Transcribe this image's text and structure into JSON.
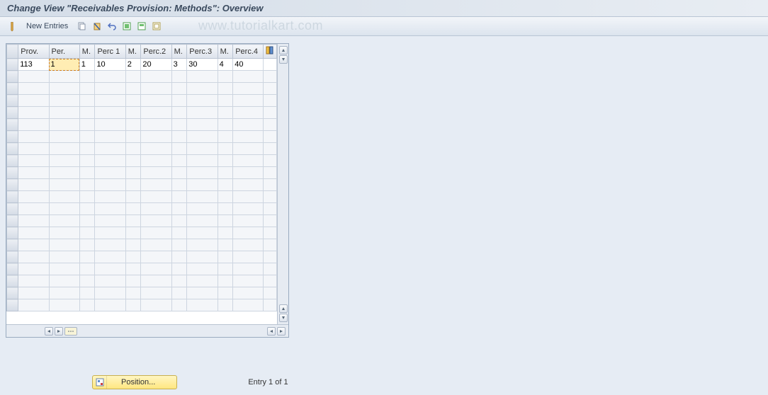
{
  "title": "Change View \"Receivables Provision: Methods\": Overview",
  "toolbar": {
    "new_entries": "New Entries"
  },
  "watermark": "www.tutorialkart.com",
  "columns": {
    "prov": "Prov.",
    "per": "Per.",
    "m1": "M.",
    "perc1": "Perc 1",
    "m2": "M.",
    "perc2": "Perc.2",
    "m3": "M.",
    "perc3": "Perc.3",
    "m4": "M.",
    "perc4": "Perc.4"
  },
  "row": {
    "prov": "113",
    "per": "1",
    "m1": "1",
    "perc1": "10",
    "m2": "2",
    "perc2": "20",
    "m3": "3",
    "perc3": "30",
    "m4": "4",
    "perc4": "40"
  },
  "footer": {
    "position": "Position...",
    "entry": "Entry 1 of 1"
  }
}
